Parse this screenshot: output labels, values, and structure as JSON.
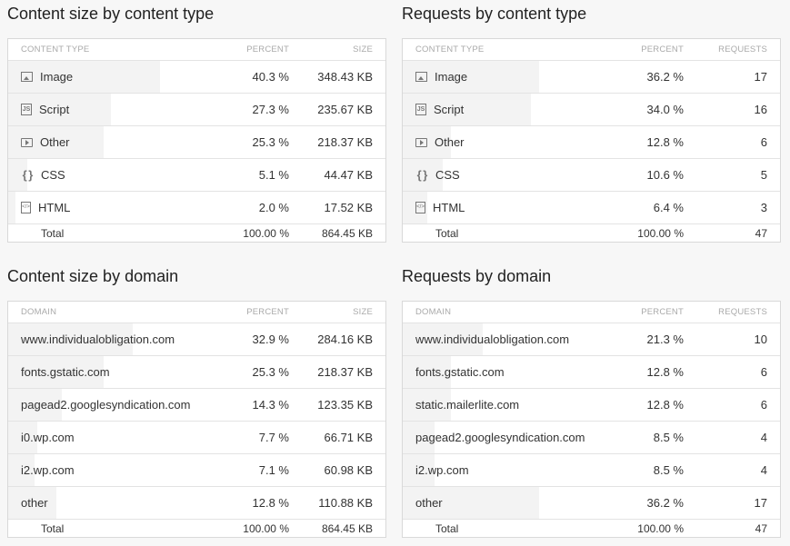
{
  "panels": [
    {
      "title": "Content size by content type",
      "headers": [
        "CONTENT TYPE",
        "PERCENT",
        "SIZE"
      ],
      "rows": [
        {
          "icon": "image-icon",
          "name": "Image",
          "percent": "40.3 %",
          "value": "348.43 KB",
          "share": 0.403
        },
        {
          "icon": "script-icon",
          "name": "Script",
          "percent": "27.3 %",
          "value": "235.67 KB",
          "share": 0.273
        },
        {
          "icon": "play-icon",
          "name": "Other",
          "percent": "25.3 %",
          "value": "218.37 KB",
          "share": 0.253
        },
        {
          "icon": "braces-icon",
          "name": "CSS",
          "percent": "5.1 %",
          "value": "44.47 KB",
          "share": 0.051
        },
        {
          "icon": "html-file-icon",
          "name": "HTML",
          "percent": "2.0 %",
          "value": "17.52 KB",
          "share": 0.02
        }
      ],
      "total": {
        "name": "Total",
        "percent": "100.00 %",
        "value": "864.45 KB"
      }
    },
    {
      "title": "Requests by content type",
      "headers": [
        "CONTENT TYPE",
        "PERCENT",
        "REQUESTS"
      ],
      "rows": [
        {
          "icon": "image-icon",
          "name": "Image",
          "percent": "36.2 %",
          "value": "17",
          "share": 0.362
        },
        {
          "icon": "script-icon",
          "name": "Script",
          "percent": "34.0 %",
          "value": "16",
          "share": 0.34
        },
        {
          "icon": "play-icon",
          "name": "Other",
          "percent": "12.8 %",
          "value": "6",
          "share": 0.128
        },
        {
          "icon": "braces-icon",
          "name": "CSS",
          "percent": "10.6 %",
          "value": "5",
          "share": 0.106
        },
        {
          "icon": "html-file-icon",
          "name": "HTML",
          "percent": "6.4 %",
          "value": "3",
          "share": 0.064
        }
      ],
      "total": {
        "name": "Total",
        "percent": "100.00 %",
        "value": "47"
      }
    },
    {
      "title": "Content size by domain",
      "headers": [
        "DOMAIN",
        "PERCENT",
        "SIZE"
      ],
      "rows": [
        {
          "name": "www.individualobligation.com",
          "percent": "32.9 %",
          "value": "284.16 KB",
          "share": 0.329
        },
        {
          "name": "fonts.gstatic.com",
          "percent": "25.3 %",
          "value": "218.37 KB",
          "share": 0.253
        },
        {
          "name": "pagead2.googlesyndication.com",
          "percent": "14.3 %",
          "value": "123.35 KB",
          "share": 0.143
        },
        {
          "name": "i0.wp.com",
          "percent": "7.7 %",
          "value": "66.71 KB",
          "share": 0.077
        },
        {
          "name": "i2.wp.com",
          "percent": "7.1 %",
          "value": "60.98 KB",
          "share": 0.071
        },
        {
          "name": "other",
          "percent": "12.8 %",
          "value": "110.88 KB",
          "share": 0.128
        }
      ],
      "total": {
        "name": "Total",
        "percent": "100.00 %",
        "value": "864.45 KB"
      }
    },
    {
      "title": "Requests by domain",
      "headers": [
        "DOMAIN",
        "PERCENT",
        "REQUESTS"
      ],
      "rows": [
        {
          "name": "www.individualobligation.com",
          "percent": "21.3 %",
          "value": "10",
          "share": 0.213
        },
        {
          "name": "fonts.gstatic.com",
          "percent": "12.8 %",
          "value": "6",
          "share": 0.128
        },
        {
          "name": "static.mailerlite.com",
          "percent": "12.8 %",
          "value": "6",
          "share": 0.128
        },
        {
          "name": "pagead2.googlesyndication.com",
          "percent": "8.5 %",
          "value": "4",
          "share": 0.085
        },
        {
          "name": "i2.wp.com",
          "percent": "8.5 %",
          "value": "4",
          "share": 0.085
        },
        {
          "name": "other",
          "percent": "36.2 %",
          "value": "17",
          "share": 0.362
        }
      ],
      "total": {
        "name": "Total",
        "percent": "100.00 %",
        "value": "47"
      }
    }
  ]
}
